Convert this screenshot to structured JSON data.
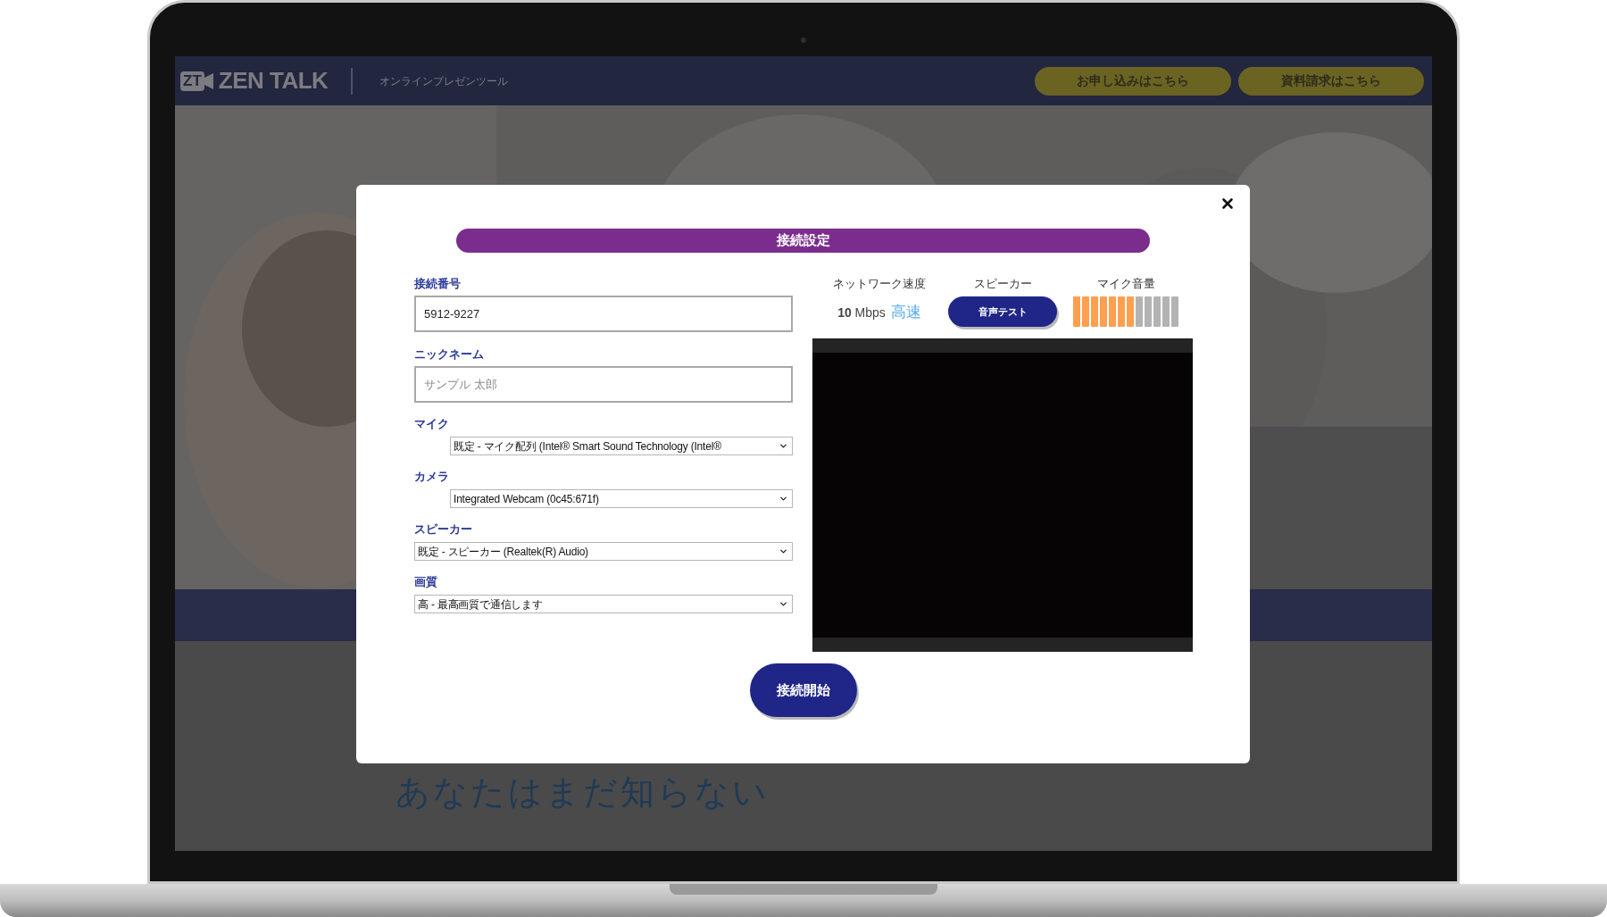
{
  "header": {
    "logo_mark": "ZT",
    "logo_text": "ZEN TALK",
    "tagline": "オンラインプレゼンツール",
    "buttons": [
      "お申し込みはこちら",
      "資料請求はこちら"
    ]
  },
  "page_heading": "あなたはまだ知らない",
  "dialog": {
    "title": "接続設定",
    "fields": [
      {
        "kind": "text",
        "label": "接続番号",
        "value": "5912-9227"
      },
      {
        "kind": "text",
        "label": "ニックネーム",
        "placeholder": "サンプル 太郎"
      },
      {
        "kind": "select",
        "label": "マイク",
        "value": "既定 - マイク配列 (Intel® Smart Sound Technology (Intel®",
        "indented": true
      },
      {
        "kind": "select",
        "label": "カメラ",
        "value": "Integrated Webcam (0c45:671f)",
        "indented": true
      },
      {
        "kind": "select",
        "label": "スピーカー",
        "value": "既定 - スピーカー (Realtek(R) Audio)",
        "indented": false
      },
      {
        "kind": "select",
        "label": "画質",
        "value": "高 - 最高画質で通信します",
        "indented": false
      }
    ],
    "network": {
      "label": "ネットワーク速度",
      "speed": "10",
      "unit": "Mbps",
      "rating": "高速"
    },
    "speaker": {
      "label": "スピーカー",
      "button": "音声テスト"
    },
    "mic_volume": {
      "label": "マイク音量",
      "level": 0.58
    },
    "start_button": "接続開始"
  }
}
